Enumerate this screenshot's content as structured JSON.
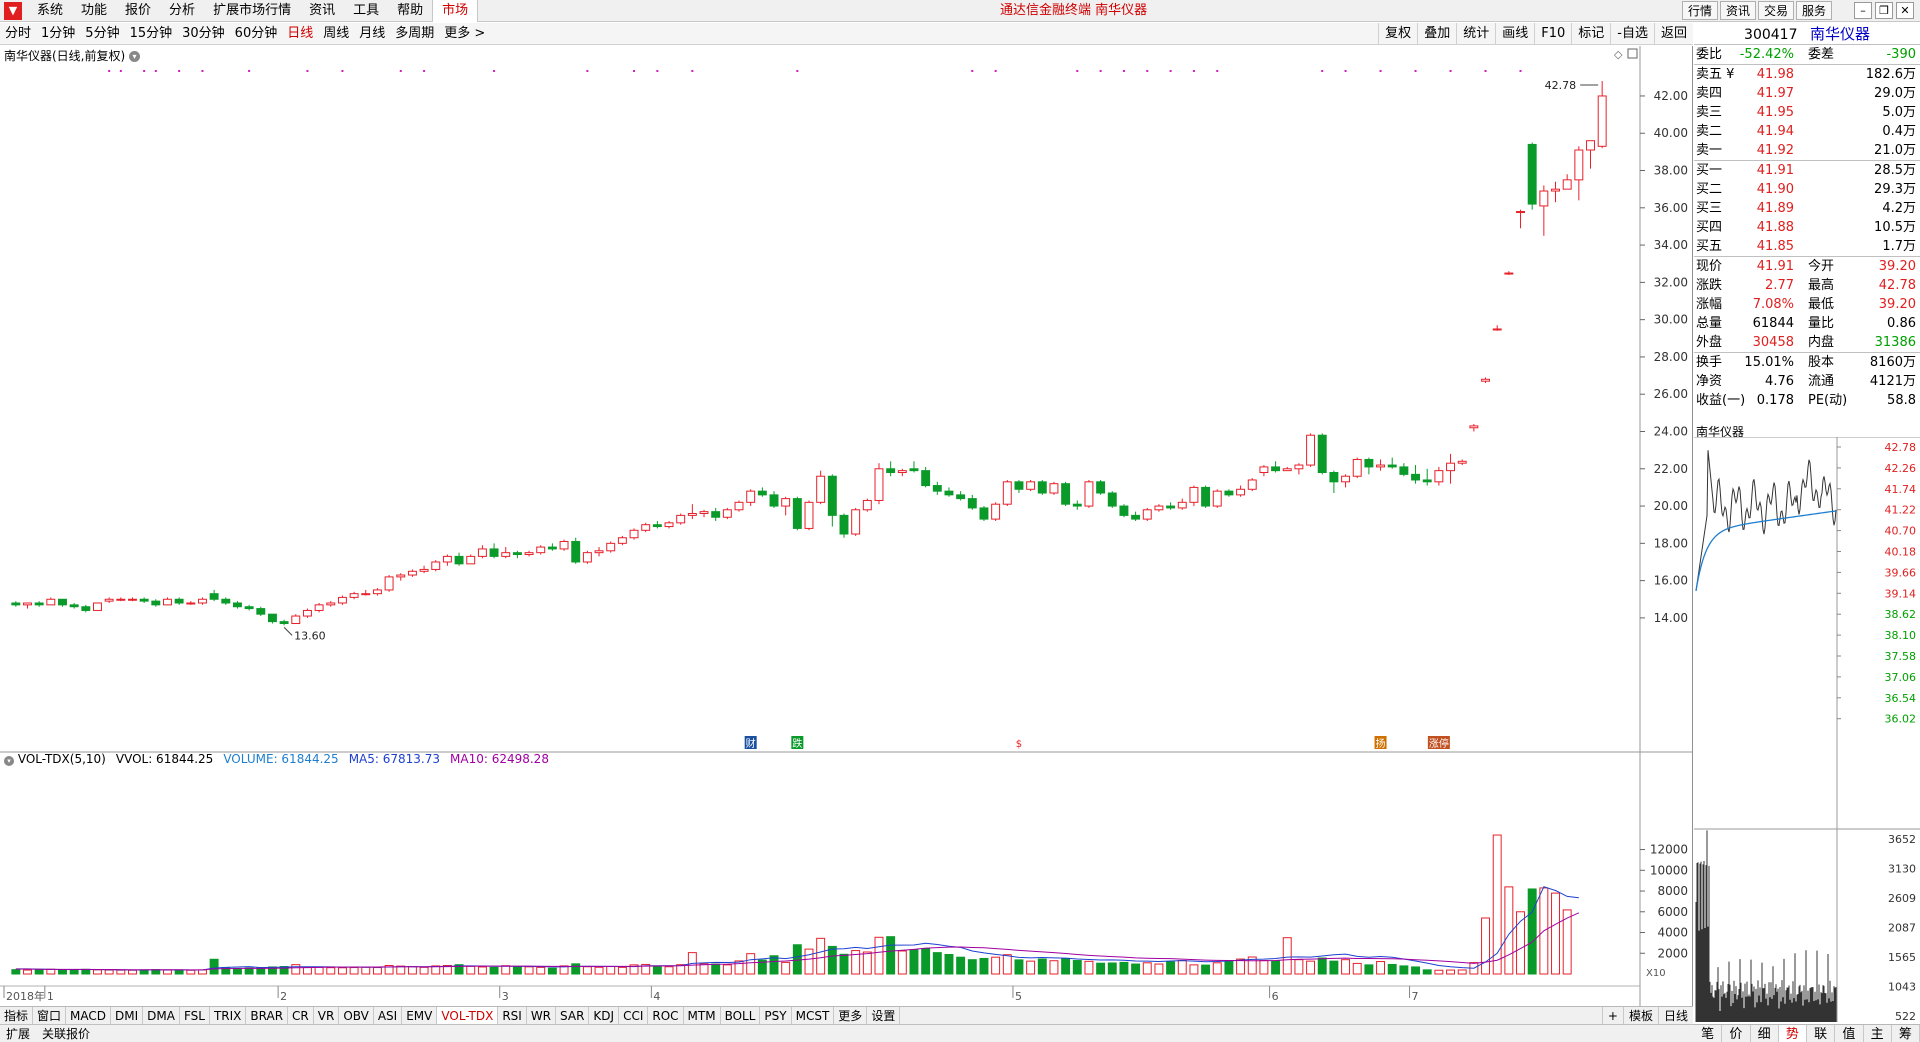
{
  "menu": {
    "logo": "▼",
    "items": [
      "系统",
      "功能",
      "报价",
      "分析",
      "扩展市场行情",
      "资讯",
      "工具",
      "帮助"
    ],
    "active": "市场",
    "center_title": "通达信金融终端  南华仪器",
    "right_tabs": [
      "行情",
      "资讯",
      "交易",
      "服务"
    ]
  },
  "periods": {
    "items": [
      "分时",
      "1分钟",
      "5分钟",
      "15分钟",
      "30分钟",
      "60分钟",
      "日线",
      "周线",
      "月线",
      "多周期",
      "更多 >"
    ],
    "active": "日线",
    "tools": [
      "复权",
      "叠加",
      "统计",
      "画线",
      "F10",
      "标记",
      "-自选",
      "返回"
    ]
  },
  "chart": {
    "stock_title": "南华仪器(日线,前复权)",
    "high_label": "42.78",
    "low_label": "13.60",
    "y_ticks": [
      "42.00",
      "40.00",
      "38.00",
      "36.00",
      "34.00",
      "32.00",
      "30.00",
      "28.00",
      "26.00",
      "24.00",
      "22.00",
      "20.00",
      "18.00",
      "16.00",
      "14.00"
    ],
    "month_labels": [
      "2018年",
      "1",
      "2",
      "3",
      "4",
      "5",
      "6",
      "7"
    ],
    "event_markers": [
      "财",
      "跌",
      "$",
      "扬",
      "涨停"
    ],
    "vol_title": "VOL-TDX(5,10)",
    "vol_values": {
      "vvol": "VVOL: 61844.25",
      "volume": "VOLUME: 61844.25",
      "ma5": "MA5: 67813.73",
      "ma10": "MA10: 62498.28"
    },
    "vol_ticks": [
      "12000",
      "10000",
      "8000",
      "6000",
      "4000",
      "2000"
    ],
    "vol_unit": "X10"
  },
  "indicators": {
    "items": [
      "指标",
      "窗口",
      "MACD",
      "DMI",
      "DMA",
      "FSL",
      "TRIX",
      "BRAR",
      "CR",
      "VR",
      "OBV",
      "ASI",
      "EMV",
      "VOL-TDX",
      "RSI",
      "WR",
      "SAR",
      "KDJ",
      "CCI",
      "ROC",
      "MTM",
      "BOLL",
      "PSY",
      "MCST",
      "更多",
      "设置"
    ],
    "active": "VOL-TDX",
    "right": [
      "+",
      "模板",
      "日线"
    ]
  },
  "status": [
    "扩展",
    "关联报价"
  ],
  "quote": {
    "code": "300417",
    "name": "南华仪器",
    "weibi": {
      "label": "委比",
      "value": "-52.42%",
      "label2": "委差",
      "value2": "-390"
    },
    "asks": [
      {
        "label": "卖五 ¥",
        "price": "41.98",
        "vol": "182.6万"
      },
      {
        "label": "卖四",
        "price": "41.97",
        "vol": "29.0万"
      },
      {
        "label": "卖三",
        "price": "41.95",
        "vol": "5.0万"
      },
      {
        "label": "卖二",
        "price": "41.94",
        "vol": "0.4万"
      },
      {
        "label": "卖一",
        "price": "41.92",
        "vol": "21.0万"
      }
    ],
    "bids": [
      {
        "label": "买一",
        "price": "41.91",
        "vol": "28.5万"
      },
      {
        "label": "买二",
        "price": "41.90",
        "vol": "29.3万"
      },
      {
        "label": "买三",
        "price": "41.89",
        "vol": "4.2万"
      },
      {
        "label": "买四",
        "price": "41.88",
        "vol": "10.5万"
      },
      {
        "label": "买五",
        "price": "41.85",
        "vol": "1.7万"
      }
    ],
    "stats1": [
      {
        "l1": "现价",
        "v1": "41.91",
        "l2": "今开",
        "v2": "39.20"
      },
      {
        "l1": "涨跌",
        "v1": "2.77",
        "l2": "最高",
        "v2": "42.78"
      },
      {
        "l1": "涨幅",
        "v1": "7.08%",
        "l2": "最低",
        "v2": "39.20"
      },
      {
        "l1": "总量",
        "v1": "61844",
        "l2": "量比",
        "v2": "0.86"
      },
      {
        "l1": "外盘",
        "v1": "30458",
        "l2": "内盘",
        "v2": "31386"
      }
    ],
    "stats2": [
      {
        "l1": "换手",
        "v1": "15.01%",
        "l2": "股本",
        "v2": "8160万"
      },
      {
        "l1": "净资",
        "v1": "4.76",
        "l2": "流通",
        "v2": "4121万"
      },
      {
        "l1": "收益(一)",
        "v1": "0.178",
        "l2": "PE(动)",
        "v2": "58.8"
      }
    ],
    "mini_title": "南华仪器",
    "mini_prices": [
      "42.78",
      "42.26",
      "41.74",
      "41.22",
      "40.70",
      "40.18",
      "39.66",
      "39.14",
      "38.62",
      "38.10",
      "37.58",
      "37.06",
      "36.54",
      "36.02"
    ],
    "mini_vols": [
      "3652",
      "3130",
      "2609",
      "2087",
      "1565",
      "1043",
      "522"
    ],
    "tabs": [
      "笔",
      "价",
      "细",
      "势",
      "联",
      "值",
      "主",
      "筹"
    ],
    "active_tab": "势"
  },
  "chart_data": {
    "type": "candlestick",
    "y_range": [
      12.6,
      43.5
    ],
    "vol_range": [
      0,
      13500
    ],
    "ohlc": [
      [
        14.8,
        14.9,
        14.6,
        14.7
      ],
      [
        14.7,
        14.8,
        14.5,
        14.8
      ],
      [
        14.8,
        14.9,
        14.6,
        14.7
      ],
      [
        14.7,
        15.1,
        14.7,
        15.0
      ],
      [
        15.0,
        15.0,
        14.6,
        14.7
      ],
      [
        14.7,
        14.8,
        14.5,
        14.6
      ],
      [
        14.6,
        14.7,
        14.3,
        14.4
      ],
      [
        14.4,
        14.8,
        14.4,
        14.8
      ],
      [
        14.9,
        15.1,
        14.8,
        15.0
      ],
      [
        15.0,
        15.1,
        14.9,
        15.0
      ],
      [
        15.0,
        15.1,
        14.9,
        15.0
      ],
      [
        15.0,
        15.1,
        14.8,
        14.9
      ],
      [
        14.9,
        15.0,
        14.6,
        14.7
      ],
      [
        14.7,
        15.1,
        14.7,
        15.0
      ],
      [
        15.0,
        15.1,
        14.7,
        14.8
      ],
      [
        14.8,
        14.9,
        14.7,
        14.8
      ],
      [
        14.8,
        15.1,
        14.7,
        15.0
      ],
      [
        15.3,
        15.5,
        14.9,
        15.0
      ],
      [
        15.0,
        15.1,
        14.7,
        14.8
      ],
      [
        14.8,
        14.9,
        14.5,
        14.6
      ],
      [
        14.6,
        14.7,
        14.4,
        14.5
      ],
      [
        14.5,
        14.6,
        14.1,
        14.2
      ],
      [
        14.2,
        14.2,
        13.7,
        13.8
      ],
      [
        13.8,
        13.9,
        13.6,
        13.7
      ],
      [
        13.7,
        14.2,
        13.7,
        14.1
      ],
      [
        14.1,
        14.5,
        14.0,
        14.4
      ],
      [
        14.4,
        14.8,
        14.3,
        14.7
      ],
      [
        14.7,
        14.9,
        14.6,
        14.8
      ],
      [
        14.8,
        15.2,
        14.7,
        15.1
      ],
      [
        15.1,
        15.4,
        15.0,
        15.3
      ],
      [
        15.3,
        15.5,
        15.2,
        15.3
      ],
      [
        15.3,
        15.6,
        15.2,
        15.5
      ],
      [
        15.5,
        16.3,
        15.4,
        16.2
      ],
      [
        16.2,
        16.4,
        16.0,
        16.3
      ],
      [
        16.3,
        16.6,
        16.2,
        16.5
      ],
      [
        16.5,
        16.8,
        16.4,
        16.6
      ],
      [
        16.6,
        17.1,
        16.5,
        17.0
      ],
      [
        17.0,
        17.4,
        16.8,
        17.3
      ],
      [
        17.3,
        17.5,
        16.8,
        16.9
      ],
      [
        16.9,
        17.4,
        16.9,
        17.3
      ],
      [
        17.3,
        17.9,
        17.2,
        17.7
      ],
      [
        17.7,
        18.0,
        17.2,
        17.3
      ],
      [
        17.3,
        17.8,
        17.2,
        17.5
      ],
      [
        17.5,
        17.6,
        17.2,
        17.4
      ],
      [
        17.4,
        17.6,
        17.3,
        17.5
      ],
      [
        17.5,
        17.9,
        17.4,
        17.8
      ],
      [
        17.8,
        18.0,
        17.6,
        17.7
      ],
      [
        17.7,
        18.2,
        17.6,
        18.1
      ],
      [
        18.1,
        18.3,
        16.9,
        17.0
      ],
      [
        17.0,
        17.6,
        16.9,
        17.5
      ],
      [
        17.5,
        17.8,
        17.3,
        17.6
      ],
      [
        17.6,
        18.1,
        17.5,
        18.0
      ],
      [
        18.0,
        18.4,
        17.9,
        18.3
      ],
      [
        18.3,
        18.8,
        18.2,
        18.7
      ],
      [
        18.7,
        19.1,
        18.6,
        19.0
      ],
      [
        19.0,
        19.2,
        18.8,
        18.9
      ],
      [
        18.9,
        19.2,
        18.8,
        19.1
      ],
      [
        19.1,
        19.6,
        19.0,
        19.5
      ],
      [
        19.5,
        20.1,
        19.3,
        19.6
      ],
      [
        19.6,
        19.8,
        19.4,
        19.7
      ],
      [
        19.7,
        19.9,
        19.2,
        19.4
      ],
      [
        19.4,
        19.9,
        19.3,
        19.8
      ],
      [
        19.8,
        20.3,
        19.7,
        20.2
      ],
      [
        20.2,
        20.9,
        20.0,
        20.8
      ],
      [
        20.8,
        21.0,
        20.5,
        20.6
      ],
      [
        20.6,
        20.8,
        19.9,
        20.0
      ],
      [
        20.0,
        20.5,
        19.5,
        20.4
      ],
      [
        20.4,
        20.5,
        18.7,
        18.8
      ],
      [
        18.8,
        20.3,
        18.7,
        20.2
      ],
      [
        20.2,
        21.9,
        20.1,
        21.6
      ],
      [
        21.6,
        21.7,
        18.9,
        19.5
      ],
      [
        19.5,
        19.6,
        18.3,
        18.5
      ],
      [
        18.5,
        19.9,
        18.4,
        19.8
      ],
      [
        19.8,
        20.4,
        19.7,
        20.3
      ],
      [
        20.3,
        22.3,
        20.1,
        22.0
      ],
      [
        22.0,
        22.4,
        21.6,
        21.8
      ],
      [
        21.8,
        22.0,
        21.6,
        21.9
      ],
      [
        22.0,
        22.4,
        21.8,
        21.9
      ],
      [
        21.9,
        22.1,
        21.0,
        21.1
      ],
      [
        21.1,
        21.3,
        20.6,
        20.8
      ],
      [
        20.8,
        21.0,
        20.5,
        20.6
      ],
      [
        20.6,
        20.8,
        20.3,
        20.4
      ],
      [
        20.4,
        20.6,
        19.8,
        19.9
      ],
      [
        19.9,
        20.0,
        19.2,
        19.3
      ],
      [
        19.3,
        20.2,
        19.2,
        20.1
      ],
      [
        20.1,
        21.4,
        20.0,
        21.3
      ],
      [
        21.3,
        21.4,
        20.7,
        20.9
      ],
      [
        20.9,
        21.4,
        20.8,
        21.3
      ],
      [
        21.3,
        21.4,
        20.6,
        20.7
      ],
      [
        20.7,
        21.3,
        20.6,
        21.2
      ],
      [
        21.2,
        21.3,
        20.0,
        20.1
      ],
      [
        20.1,
        20.3,
        19.8,
        20.0
      ],
      [
        20.0,
        21.4,
        19.9,
        21.3
      ],
      [
        21.3,
        21.4,
        20.6,
        20.7
      ],
      [
        20.7,
        20.8,
        19.9,
        20.0
      ],
      [
        20.0,
        20.1,
        19.4,
        19.5
      ],
      [
        19.5,
        19.7,
        19.2,
        19.3
      ],
      [
        19.3,
        19.9,
        19.2,
        19.8
      ],
      [
        19.8,
        20.1,
        19.7,
        20.0
      ],
      [
        20.0,
        20.2,
        19.8,
        19.9
      ],
      [
        19.9,
        20.4,
        19.8,
        20.2
      ],
      [
        20.2,
        21.1,
        20.0,
        21.0
      ],
      [
        21.0,
        21.1,
        19.9,
        20.0
      ],
      [
        20.0,
        20.9,
        19.9,
        20.8
      ],
      [
        20.8,
        20.9,
        20.5,
        20.6
      ],
      [
        20.6,
        21.1,
        20.5,
        20.9
      ],
      [
        20.9,
        21.5,
        20.8,
        21.4
      ],
      [
        21.8,
        22.2,
        21.6,
        22.1
      ],
      [
        22.1,
        22.4,
        21.8,
        21.9
      ],
      [
        21.9,
        22.1,
        21.9,
        22.0
      ],
      [
        22.0,
        22.3,
        21.7,
        22.2
      ],
      [
        22.2,
        23.9,
        22.1,
        23.8
      ],
      [
        23.8,
        23.9,
        21.7,
        21.8
      ],
      [
        21.8,
        21.9,
        20.7,
        21.3
      ],
      [
        21.3,
        21.7,
        21.0,
        21.6
      ],
      [
        21.6,
        22.6,
        21.5,
        22.5
      ],
      [
        22.5,
        22.6,
        21.7,
        22.1
      ],
      [
        22.1,
        22.5,
        21.9,
        22.2
      ],
      [
        22.2,
        22.6,
        22.0,
        22.1
      ],
      [
        22.1,
        22.3,
        21.6,
        21.7
      ],
      [
        21.7,
        22.2,
        21.2,
        21.4
      ],
      [
        21.4,
        22.0,
        21.1,
        21.3
      ],
      [
        21.3,
        22.1,
        21.1,
        21.9
      ],
      [
        21.9,
        22.8,
        21.2,
        22.3
      ],
      [
        22.3,
        22.5,
        22.2,
        22.4
      ],
      [
        24.2,
        24.4,
        24.0,
        24.3
      ],
      [
        26.7,
        26.9,
        26.6,
        26.8
      ],
      [
        29.5,
        29.7,
        29.4,
        29.5
      ],
      [
        32.5,
        32.6,
        32.4,
        32.5
      ],
      [
        35.8,
        35.9,
        34.9,
        35.8
      ],
      [
        39.4,
        39.5,
        35.9,
        36.2
      ],
      [
        36.1,
        37.2,
        34.5,
        36.9
      ],
      [
        36.9,
        37.4,
        36.3,
        37.0
      ],
      [
        37.0,
        37.8,
        37.0,
        37.5
      ],
      [
        37.5,
        39.3,
        36.4,
        39.1
      ],
      [
        39.1,
        39.6,
        38.1,
        39.6
      ],
      [
        39.3,
        42.8,
        39.2,
        42.0
      ]
    ],
    "volume": [
      420,
      380,
      400,
      460,
      430,
      420,
      450,
      400,
      380,
      370,
      360,
      400,
      420,
      380,
      370,
      360,
      390,
      1420,
      620,
      540,
      580,
      620,
      680,
      720,
      900,
      660,
      640,
      610,
      600,
      620,
      650,
      620,
      820,
      760,
      700,
      640,
      780,
      820,
      900,
      740,
      680,
      640,
      800,
      720,
      690,
      640,
      560,
      780,
      980,
      700,
      650,
      720,
      640,
      880,
      920,
      760,
      700,
      900,
      2060,
      980,
      960,
      880,
      1260,
      1960,
      1340,
      1760,
      1120,
      2820,
      2400,
      3440,
      2660,
      1900,
      2260,
      2120,
      3540,
      3600,
      2220,
      2340,
      2460,
      2060,
      1880,
      1620,
      1380,
      1500,
      1620,
      1860,
      1360,
      1240,
      1440,
      1280,
      1500,
      1300,
      1220,
      1040,
      1060,
      1120,
      960,
      1080,
      960,
      1160,
      1300,
      880,
      860,
      1080,
      1200,
      1440,
      1640,
      1300,
      1260,
      3500,
      1380,
      1240,
      1540,
      1240,
      1380,
      1020,
      880,
      1200,
      920,
      780,
      680,
      400,
      360,
      380,
      390,
      1100,
      5400,
      13400,
      8400,
      6000,
      8200,
      8300,
      7800,
      6180
    ],
    "ma5": [
      500,
      490,
      470,
      450,
      430,
      430,
      430,
      420,
      410,
      400,
      390,
      390,
      400,
      400,
      400,
      390,
      390,
      580,
      640,
      680,
      710,
      620,
      640,
      660,
      700,
      700,
      700,
      690,
      660,
      660,
      650,
      650,
      680,
      700,
      710,
      700,
      720,
      740,
      780,
      780,
      770,
      750,
      750,
      740,
      730,
      710,
      690,
      690,
      730,
      750,
      740,
      740,
      720,
      710,
      790,
      790,
      800,
      810,
      1020,
      1070,
      1120,
      1110,
      1150,
      1380,
      1460,
      1570,
      1480,
      1650,
      1860,
      2120,
      2410,
      2440,
      2570,
      2460,
      2630,
      2790,
      2780,
      2800,
      2960,
      2840,
      2680,
      2570,
      2220,
      2040,
      1890,
      1760,
      1600,
      1560,
      1590,
      1560,
      1530,
      1450,
      1400,
      1350,
      1360,
      1330,
      1250,
      1240,
      1210,
      1250,
      1290,
      1240,
      1180,
      1200,
      1260,
      1340,
      1410,
      1430,
      1490,
      1630,
      1650,
      1630,
      1740,
      1860,
      1920,
      1700,
      1620,
      1690,
      1610,
      1450,
      1250,
      1050,
      820,
      700,
      610,
      560,
      1160,
      2000,
      3830,
      5090,
      5970,
      8410,
      8050,
      7480,
      7350
    ],
    "ma10": [
      480,
      470,
      460,
      450,
      440,
      440,
      440,
      430,
      430,
      420,
      410,
      410,
      410,
      410,
      410,
      400,
      400,
      490,
      520,
      530,
      550,
      540,
      550,
      570,
      600,
      620,
      640,
      660,
      660,
      670,
      670,
      680,
      690,
      700,
      700,
      690,
      700,
      710,
      730,
      750,
      760,
      760,
      760,
      760,
      760,
      750,
      740,
      730,
      730,
      740,
      740,
      740,
      740,
      740,
      760,
      770,
      780,
      790,
      850,
      890,
      940,
      950,
      1000,
      1080,
      1130,
      1200,
      1250,
      1340,
      1440,
      1570,
      1730,
      1800,
      1880,
      1970,
      2100,
      2210,
      2290,
      2380,
      2490,
      2540,
      2590,
      2600,
      2560,
      2530,
      2450,
      2370,
      2280,
      2210,
      2130,
      2060,
      1980,
      1880,
      1800,
      1730,
      1680,
      1630,
      1550,
      1520,
      1490,
      1480,
      1440,
      1390,
      1340,
      1310,
      1300,
      1290,
      1280,
      1280,
      1300,
      1380,
      1420,
      1440,
      1470,
      1510,
      1530,
      1500,
      1490,
      1480,
      1470,
      1440,
      1380,
      1320,
      1260,
      1190,
      1110,
      1030,
      1140,
      1330,
      1850,
      2450,
      3080,
      4170,
      4790,
      5390,
      5900
    ]
  }
}
